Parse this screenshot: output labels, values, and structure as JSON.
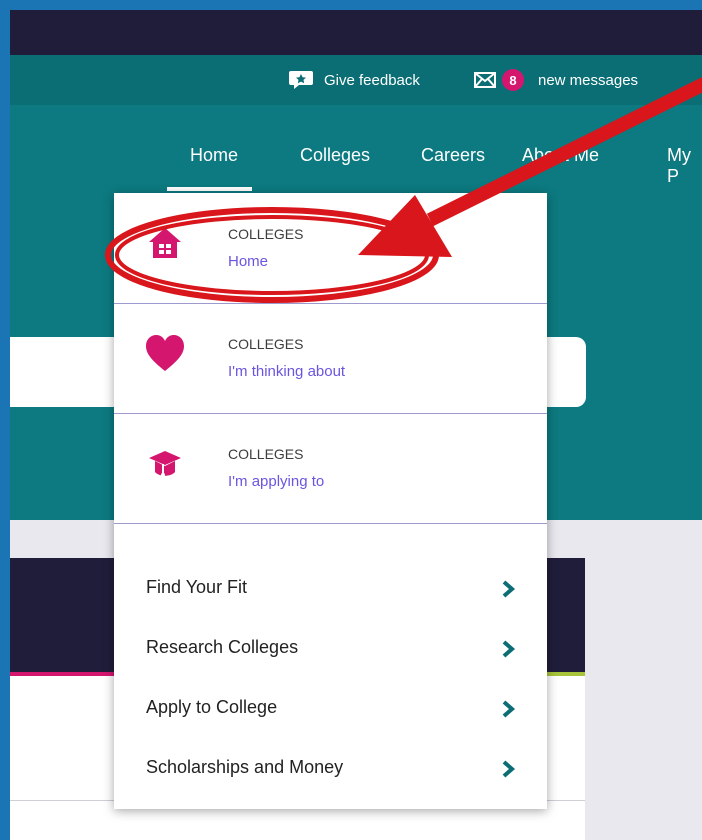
{
  "utility": {
    "feedback_label": "Give feedback",
    "message_count": "8",
    "messages_label": "new messages"
  },
  "nav": {
    "home": "Home",
    "colleges": "Colleges",
    "careers": "Careers",
    "about_me": "About Me",
    "my_partial": "My P"
  },
  "dropdown": {
    "items": [
      {
        "kicker": "COLLEGES",
        "label": "Home",
        "icon": "house-icon"
      },
      {
        "kicker": "COLLEGES",
        "label": "I'm thinking about",
        "icon": "heart-icon"
      },
      {
        "kicker": "COLLEGES",
        "label": "I'm applying to",
        "icon": "graduation-cap-icon"
      }
    ],
    "links": [
      {
        "label": "Find Your Fit"
      },
      {
        "label": "Research Colleges"
      },
      {
        "label": "Apply to College"
      },
      {
        "label": "Scholarships and Money"
      }
    ]
  },
  "colors": {
    "accent_pink": "#d4166f",
    "teal": "#0c7a80",
    "navy": "#1f1d3a",
    "annotation_red": "#d8161b",
    "link_purple": "#6b55e0"
  }
}
